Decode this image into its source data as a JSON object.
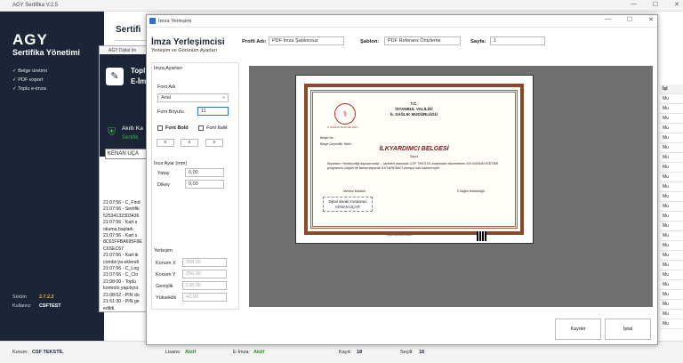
{
  "main_window": {
    "title": "AGY Sertifika V.2.5",
    "content_title": "Sertifi",
    "brand": "AGY",
    "brand_sub": "Sertifika Yönetimi",
    "features": [
      "✓ Belge üretimi",
      "✓ PDF export",
      "✓ Toplu e-imza"
    ],
    "version_label": "Sürüm",
    "version_value": "2.7.2.2",
    "user_label": "Kullanıcı",
    "user_value": "CSFTEST"
  },
  "statusbar": {
    "kurum_label": "Kurum:",
    "kurum_value": "CSF TEKSTİL",
    "lisans_label": "Lisans:",
    "lisans_value": "Aktif",
    "eimza_label": "E-İmza:",
    "eimza_value": "Aktif",
    "kayit_label": "Kayıt:",
    "kayit_value": "18",
    "secili_label": "Seçili:",
    "secili_value": "18"
  },
  "table_strip": {
    "header": "İşl",
    "cells": [
      "Mu",
      "Mu",
      "Mu",
      "Mu",
      "Mu",
      "Mu",
      "Mu",
      "Mu",
      "Mu",
      "Mu",
      "Mu",
      "Mu",
      "Mu",
      "Mu",
      "Mu",
      "Mu",
      "Mu",
      "Mu",
      "Mu",
      "Mu",
      "Mu",
      "Mu",
      "Mu",
      "Mu"
    ]
  },
  "dijital_window": {
    "title": "AGY Dijital İm",
    "header_line1": "Topl",
    "header_line2": "E-İm",
    "akilli_label": "Akıllı Ka",
    "sertifika_label": "Sertifik",
    "signer_value": "KENAN UÇA",
    "log": "21:07:56 - C_Find\n21:07:56 - Sertifik\n52534132303436\n21:07:56 - Kart s\nokuma başladı.\n21:07:56 - Kart s\n8C61FFBA695F9E\nC6SEC67\n21:07:56 - Kart ik\ncombo'ya eklendi\n21:07:56 - C_Log\n21:07:56 - C_Clo\n21:08:00 - Toplu\nkontrolü yapılıyor.\n21:08:02 - PIN do\n21:51:30 - PIN ge\nedildi."
  },
  "imza_window": {
    "title": "İmza Yerleşimi",
    "heading": "İmza Yerleşimcisi",
    "subheading": "Yerleşim ve Görünüm Ayarları",
    "profil_label": "Profil Adı:",
    "profil_value": "PDF İmza Şablonsuz",
    "sablon_label": "Şablon:",
    "sablon_value": "PDF Referans Önizleme",
    "sayfa_label": "Sayfa:",
    "sayfa_value": "1",
    "imza_ayarlari": "İmza Ayarları",
    "font_adi_label": "Font Adı",
    "font_adi_value": "Arial",
    "font_boyutu_label": "Font Boyutu",
    "font_boyutu_value": "11",
    "font_bold": "Font Bold",
    "font_italik": "Font İtalik",
    "ince_ayar": "İnce Ayar (mm)",
    "yatay_label": "Yatay",
    "yatay_value": "0,00",
    "dikey_label": "Dikey",
    "dikey_value": "0,00",
    "yerlesim": "Yerleşim",
    "konum_x_label": "Konum X",
    "konum_x_value": "208,00",
    "konum_y_label": "Konum Y",
    "konum_y_value": "256,00",
    "genislik_label": "Genişlik",
    "genislik_value": "138,00",
    "yukseklik_label": "Yükseklik",
    "yukseklik_value": "43,00",
    "kaydet": "Kaydet",
    "iptal": "İptal"
  },
  "certificate": {
    "tc": "T.C.",
    "valilik": "İSTANBUL VALİLİĞİ",
    "mudurluk": "İL SAĞLIK MÜDÜRLÜĞÜ",
    "logo_text": "İL SAĞLIK MÜDÜRLÜĞÜ",
    "belge_no": "Belge No :",
    "belge_tarih": "Belge Geçerlilik Tarihi :",
    "belge_title": "İLKYARDIMCI BELGESİ",
    "sayin": "Sayın",
    "body": "İlkyardım Yönetmeliği kapsamında ... tarihleri arasında CSF TEKSTİL tarafından düzenlenen İLKYARDIM EĞİTİMİ programını başarı ile tamamlayarak İLKYARDIMCI olmaya hak kazanmıştır.",
    "sig_left_title": "Merkez Müdürü",
    "sig_right_title": "İl Sağlık Müdürlüğü",
    "sign_line1": "Dijital olarak imzalanan",
    "sign_line2": "KENAN UÇAR",
    "footer": "Belge doğrulama bilgileri"
  }
}
